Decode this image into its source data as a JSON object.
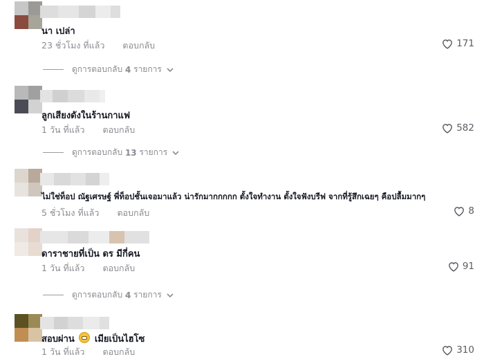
{
  "colors": {
    "text": "#161823",
    "muted": "#8a8b91",
    "heart": "#5b5c63"
  },
  "comments": [
    {
      "avatar": [
        "#c7c7c7",
        "#9b9a96",
        "#8b4a3e",
        "#a7a49a"
      ],
      "username_blocks": [
        "#dddddd",
        "#e6e6e6",
        "#d5d5d5",
        "#ececec",
        "#dedede"
      ],
      "text": "นา      เปล่า",
      "time": "23 ชั่วโมง ที่แล้ว",
      "reply_label": "ตอบกลับ",
      "likes": "171",
      "replies": {
        "prefix": "ดูการตอบกลับ",
        "count": "4",
        "suffix": "รายการ"
      }
    },
    {
      "avatar": [
        "#b9b9b9",
        "#a0a0a0",
        "#4b4b55",
        "#d2d2d2"
      ],
      "username_blocks": [
        "#e3e3e3",
        "#d0d0d0",
        "#dcdcdc",
        "#e9e9e9",
        "#f0f0f0"
      ],
      "text": "ลูกเสียงดังในร้านกาแฟ",
      "time": "1 วัน ที่แล้ว",
      "reply_label": "ตอบกลับ",
      "likes": "582",
      "replies": {
        "prefix": "ดูการตอบกลับ",
        "count": "13",
        "suffix": "รายการ"
      }
    },
    {
      "avatar": [
        "#ddd6cf",
        "#b9a99a",
        "#e7e3de",
        "#cfc6bd"
      ],
      "username_blocks": [
        "#e8e8e8",
        "#d9d9d9",
        "#e2e2e2",
        "#d4d4d4",
        "#eeeeee"
      ],
      "text": "ไม่ใช่ท็อป ณัฐเศรษฐ์ พี่ท็อปชั้นเจอมาแล้ว น่ารักมากกกกก ตั้งใจทำงาน ตั้งใจฟังบรีฟ จากที่รู้สึกเฉยๆ คือปลื้มมากๆ",
      "time": "5 ชั่วโมง ที่แล้ว",
      "reply_label": "ตอบกลับ",
      "likes": "8",
      "replies": null
    },
    {
      "avatar": [
        "#e9e1dc",
        "#e2d2c8",
        "#f0e9e4",
        "#e8dcd2"
      ],
      "username_blocks": [
        "#e6e6e6",
        "#dadada",
        "#ececec",
        "#d8c3b0",
        "#e1e1e1"
      ],
      "text": "ดาราชายที่เป็น ดร มีกี่คน",
      "time": "1 วัน ที่แล้ว",
      "reply_label": "ตอบกลับ",
      "likes": "91",
      "replies": {
        "prefix": "ดูการตอบกลับ",
        "count": "4",
        "suffix": "รายการ"
      }
    },
    {
      "avatar": [
        "#5b5123",
        "#9c8a55",
        "#c08e52",
        "#d9c3a5"
      ],
      "username_blocks": [
        "#e4e4e4",
        "#d2d2d2",
        "#dddddd",
        "#ebebeb",
        "#e0e0e0"
      ],
      "text_before": "สอบผ่าน",
      "emoji": "grimacing-face",
      "text_after": "เมียเป็นไฮโซ",
      "time": "1 วัน ที่แล้ว",
      "reply_label": "ตอบกลับ",
      "likes": "310",
      "replies": null
    }
  ]
}
